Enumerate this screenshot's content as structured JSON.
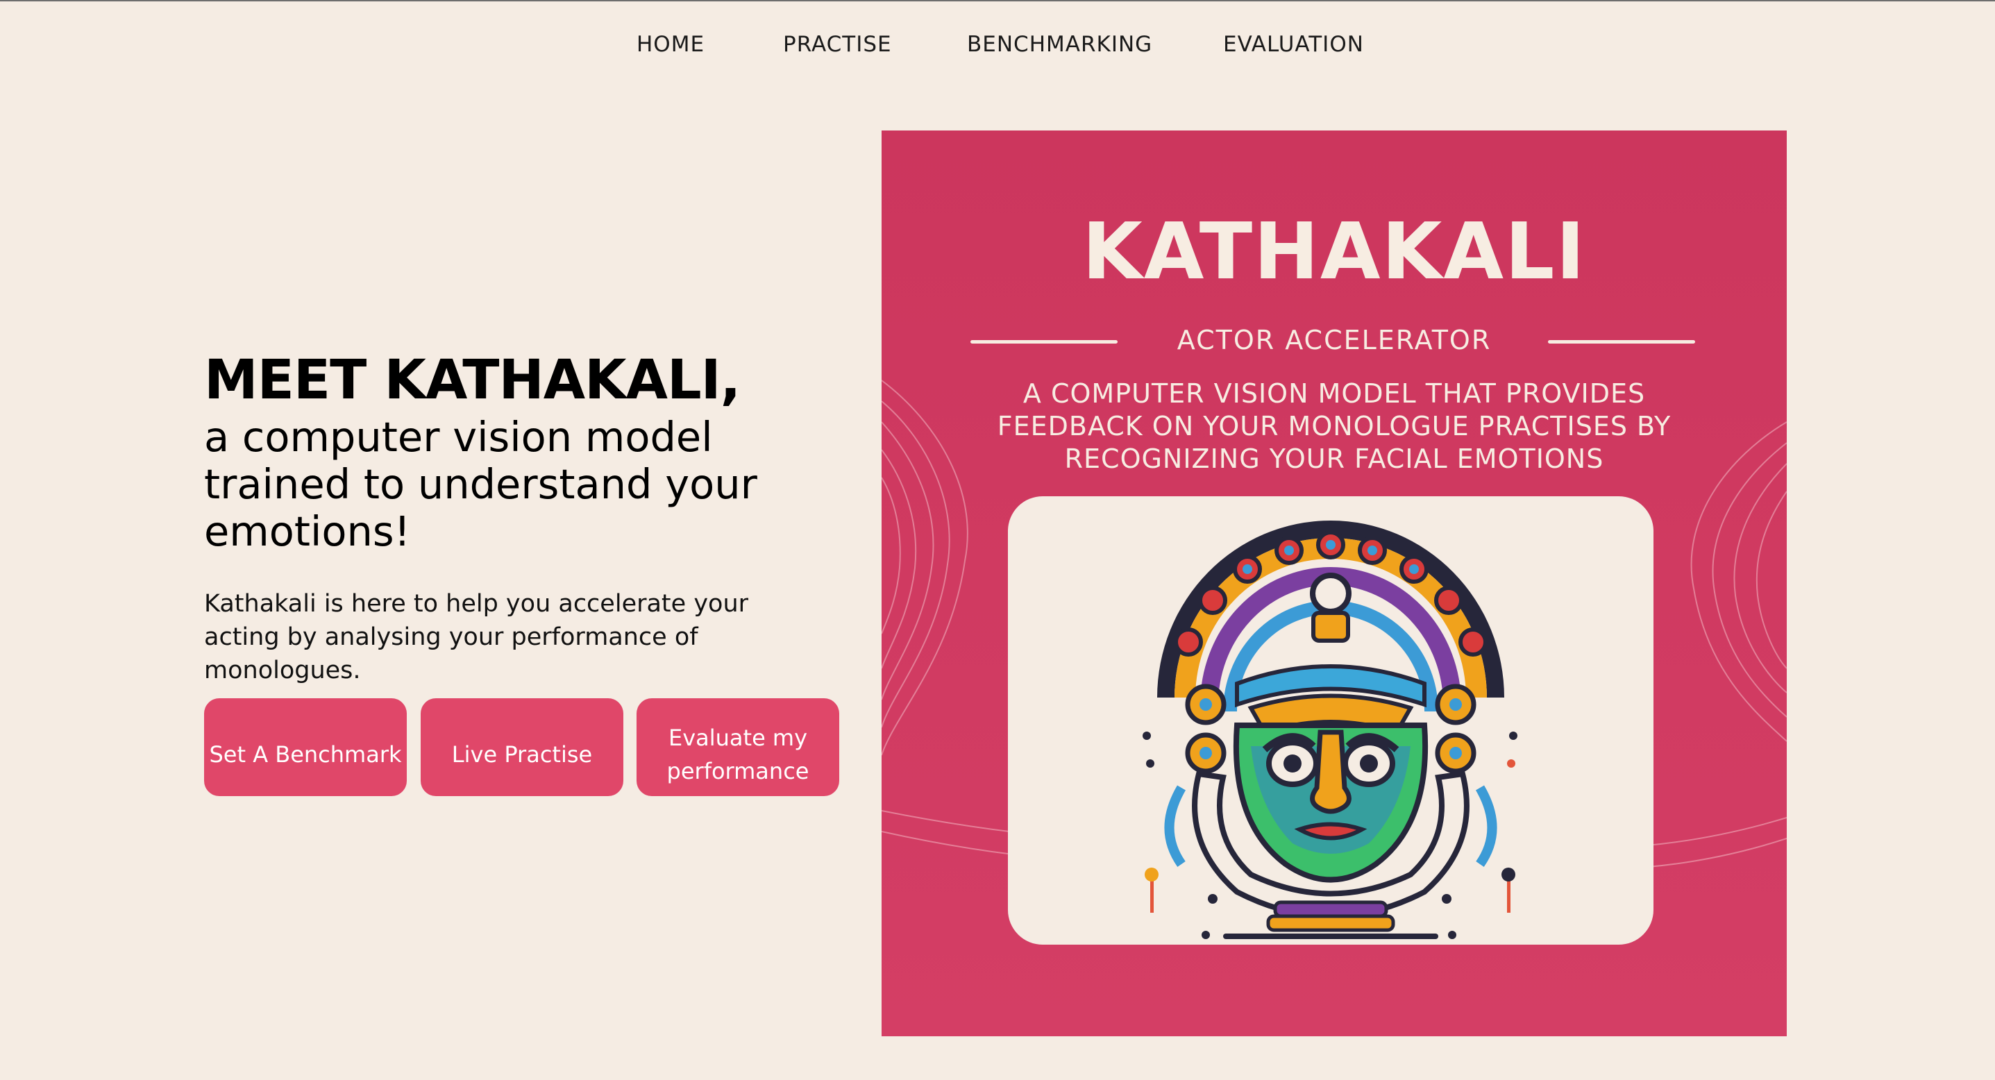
{
  "nav": {
    "items": [
      "HOME",
      "PRACTISE",
      "BENCHMARKING",
      "EVALUATION"
    ]
  },
  "hero": {
    "title": "MEET KATHAKALI,",
    "subtitle": "a computer vision model trained to understand your emotions!",
    "description": "Kathakali is here to help you accelerate your acting by analysing your performance of monologues.",
    "buttons": [
      "Set A Benchmark",
      "Live Practise",
      "Evaluate my performance"
    ]
  },
  "poster": {
    "title": "KATHAKALI",
    "subtitle": "ACTOR  ACCELERATOR",
    "description": "A COMPUTER VISION MODEL THAT PROVIDES FEEDBACK ON YOUR MONOLOGUE PRACTISES BY RECOGNIZING YOUR FACIAL EMOTIONS",
    "image_icon": "kathakali-mask-icon"
  },
  "colors": {
    "background": "#f5ece3",
    "accent": "#e04769",
    "poster": "#cc365d",
    "poster_text": "#f7ede2"
  }
}
